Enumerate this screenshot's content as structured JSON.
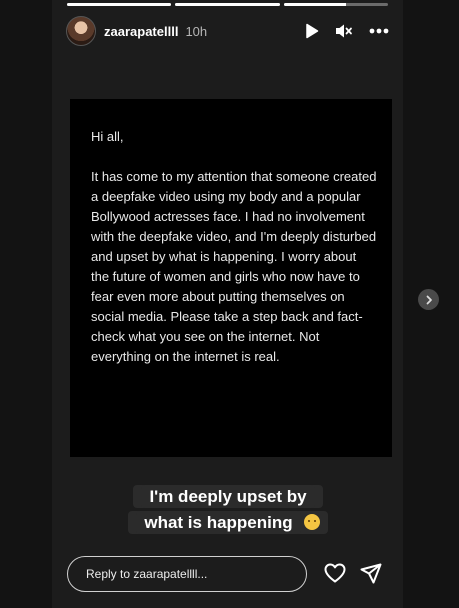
{
  "progress": {
    "segments": [
      1,
      1,
      0.6
    ]
  },
  "header": {
    "username": "zaarapatellll",
    "time": "10h"
  },
  "icons": {
    "play": "play-icon",
    "mute": "mute-icon",
    "more": "more-icon",
    "heart": "heart-icon",
    "send": "send-icon",
    "next": "chevron-right-icon"
  },
  "story": {
    "greeting": "Hi all,",
    "body": "It has come to my attention that someone created a deepfake video using my body and a popular Bollywood actresses face. I had no involvement with the deepfake video, and I'm deeply disturbed and upset by what is happening. I worry about the future of women and girls who now have to fear even more about putting themselves on social media. Please take a step back and fact-check what you see on the internet. Not everything on the internet is real.",
    "caption_line1": "I'm deeply upset by",
    "caption_line2": "what is happening"
  },
  "reply": {
    "placeholder": "Reply to zaarapatellll..."
  }
}
